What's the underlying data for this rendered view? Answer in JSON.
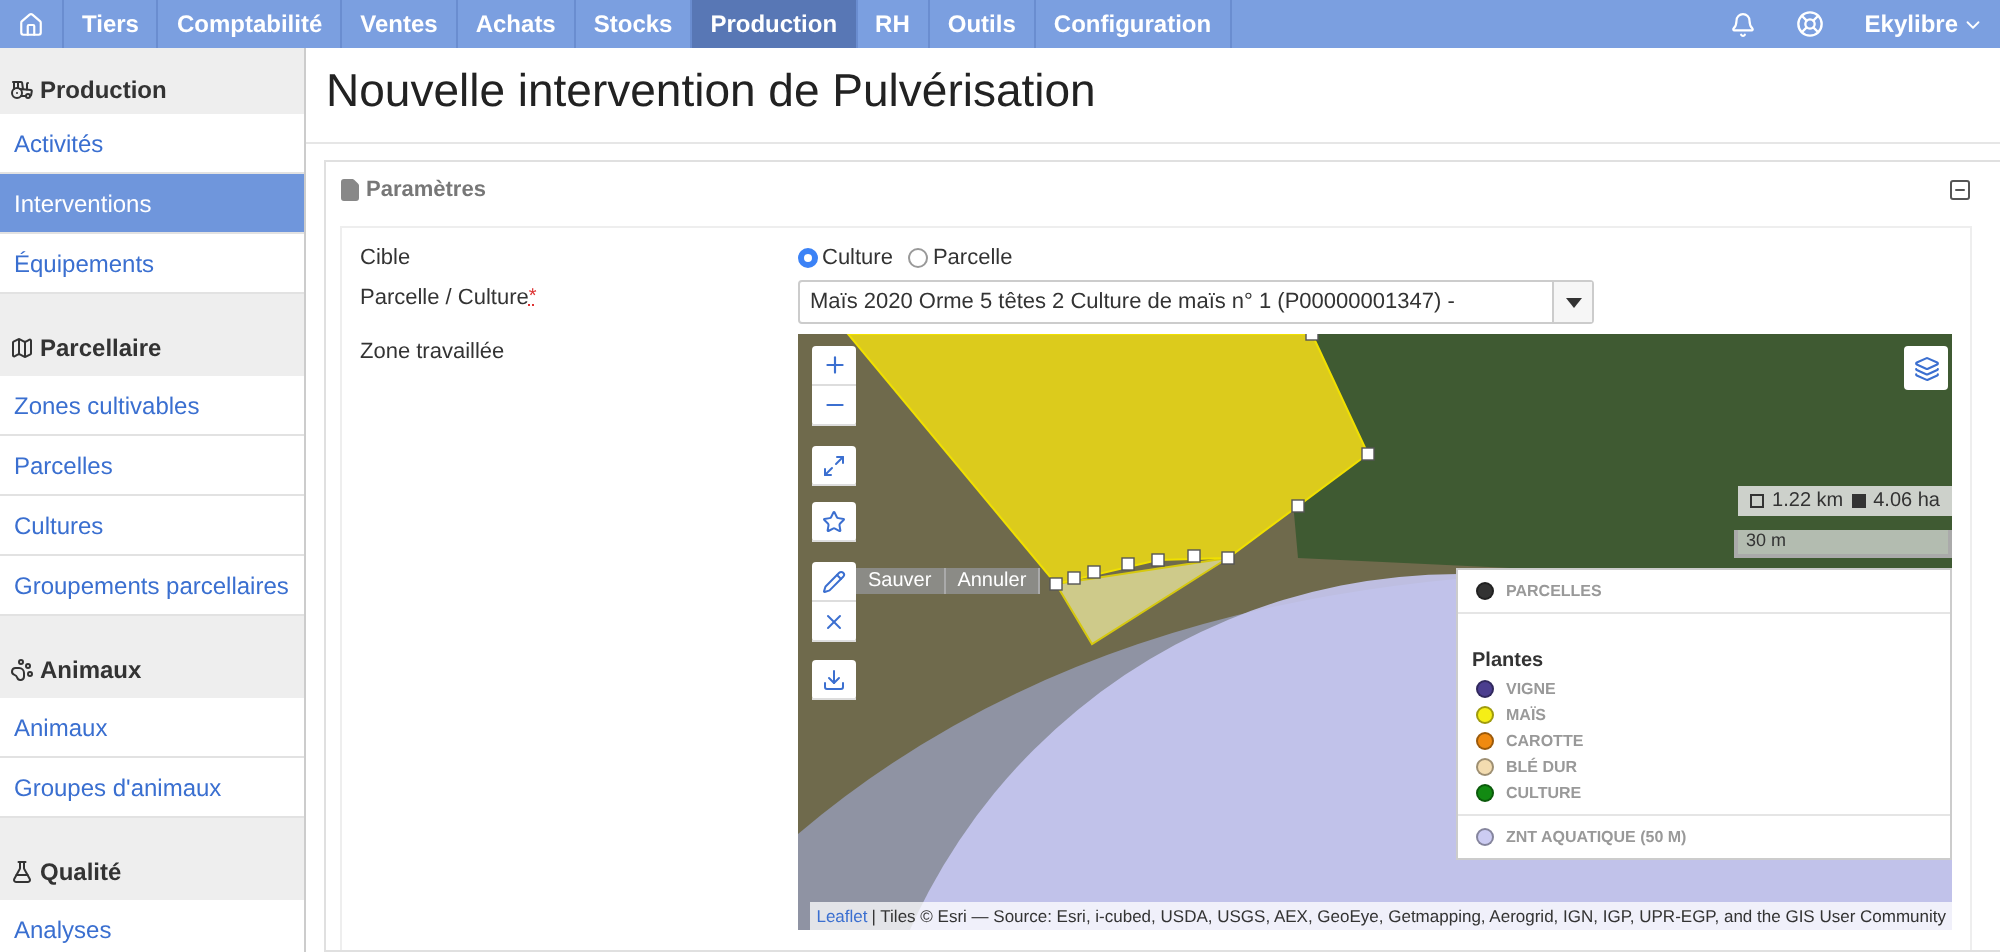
{
  "navbar": {
    "items": [
      {
        "label": "Tiers",
        "selected": false
      },
      {
        "label": "Comptabilité",
        "selected": false
      },
      {
        "label": "Ventes",
        "selected": false
      },
      {
        "label": "Achats",
        "selected": false
      },
      {
        "label": "Stocks",
        "selected": false
      },
      {
        "label": "Production",
        "selected": true
      },
      {
        "label": "RH",
        "selected": false
      },
      {
        "label": "Outils",
        "selected": false
      },
      {
        "label": "Configuration",
        "selected": false
      }
    ],
    "user": "Ekylibre"
  },
  "sidebar": {
    "sections": [
      {
        "title": "Production",
        "items": [
          {
            "label": "Activités",
            "selected": false
          },
          {
            "label": "Interventions",
            "selected": true
          },
          {
            "label": "Équipements",
            "selected": false
          }
        ]
      },
      {
        "title": "Parcellaire",
        "items": [
          {
            "label": "Zones cultivables",
            "selected": false
          },
          {
            "label": "Parcelles",
            "selected": false
          },
          {
            "label": "Cultures",
            "selected": false
          },
          {
            "label": "Groupements parcellaires",
            "selected": false
          }
        ]
      },
      {
        "title": "Animaux",
        "items": [
          {
            "label": "Animaux",
            "selected": false
          },
          {
            "label": "Groupes d'animaux",
            "selected": false
          }
        ]
      },
      {
        "title": "Qualité",
        "items": [
          {
            "label": "Analyses",
            "selected": false
          }
        ]
      }
    ]
  },
  "page": {
    "title": "Nouvelle intervention de Pulvérisation"
  },
  "panel": {
    "title": "Paramètres",
    "cible": {
      "label": "Cible",
      "options": [
        {
          "label": "Culture",
          "selected": true
        },
        {
          "label": "Parcelle",
          "selected": false
        }
      ]
    },
    "parcelle": {
      "label": "Parcelle / Culture",
      "required_mark": "*",
      "value": "Maïs 2020 Orme 5 têtes 2 Culture de maïs n° 1 (P00000001347) -"
    },
    "zone": {
      "label": "Zone travaillée"
    }
  },
  "map": {
    "draw_actions": [
      "Sauver",
      "Annuler"
    ],
    "measure": {
      "perimeter": "1.22 km",
      "area": "4.06 ha"
    },
    "scale": "30 m",
    "legend": {
      "top": {
        "label": "PARCELLES",
        "color": "#333333"
      },
      "group_title": "Plantes",
      "items": [
        {
          "label": "VIGNE",
          "color": "#4b3e8f"
        },
        {
          "label": "MAÏS",
          "color": "#f5ee16"
        },
        {
          "label": "CAROTTE",
          "color": "#f08a10"
        },
        {
          "label": "BLÉ DUR",
          "color": "#f3dcb0"
        },
        {
          "label": "CULTURE",
          "color": "#128a12"
        }
      ],
      "bottom": {
        "label": "ZNT AQUATIQUE (50 M)",
        "color": "#ccccf2"
      }
    },
    "attribution": {
      "link": "Leaflet",
      "text": "| Tiles © Esri — Source: Esri, i-cubed, USDA, USGS, AEX, GeoEye, Getmapping, Aerogrid, IGN, IGP, UPR-EGP, and the GIS User Community"
    }
  }
}
